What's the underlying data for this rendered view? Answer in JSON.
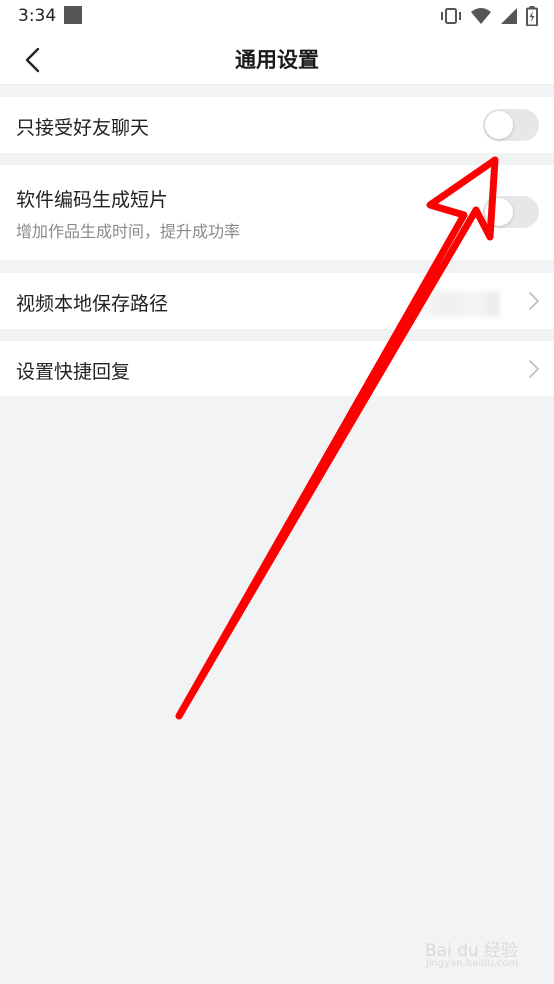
{
  "status_bar": {
    "time": "3:34",
    "icons": [
      "vibrate-icon",
      "wifi-icon",
      "signal-icon",
      "battery-icon"
    ]
  },
  "header": {
    "title": "通用设置",
    "back_icon": "chevron-left-icon"
  },
  "settings": {
    "friends_only_chat": {
      "label": "只接受好友聊天",
      "enabled": false
    },
    "software_encoding": {
      "label": "软件编码生成短片",
      "description": "增加作品生成时间，提升成功率",
      "enabled": false
    },
    "local_save_path": {
      "label": "视频本地保存路径"
    },
    "quick_reply": {
      "label": "设置快捷回复"
    }
  },
  "colors": {
    "background": "#f2f3f5",
    "card": "#ffffff",
    "toggle_off": "#e7e7ea",
    "annotation_arrow": "#ff0000"
  },
  "watermark": {
    "brand": "Bai du 经验",
    "url": "jingyan.baidu.com"
  }
}
